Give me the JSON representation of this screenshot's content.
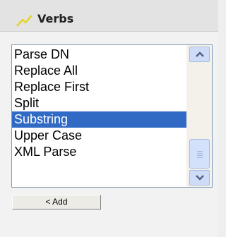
{
  "header": {
    "title": "Verbs",
    "icon": "lightning-icon"
  },
  "verbs_list": {
    "items": [
      {
        "label": "Parse DN"
      },
      {
        "label": "Replace All"
      },
      {
        "label": "Replace First"
      },
      {
        "label": "Split"
      },
      {
        "label": "Substring"
      },
      {
        "label": "Upper Case"
      },
      {
        "label": "XML Parse"
      }
    ],
    "selected": "Substring"
  },
  "add_button": {
    "label": "< Add"
  },
  "colors": {
    "selection": "#316ac5",
    "header_bg": "#e3e3e3",
    "icon": "#e3d42a"
  }
}
